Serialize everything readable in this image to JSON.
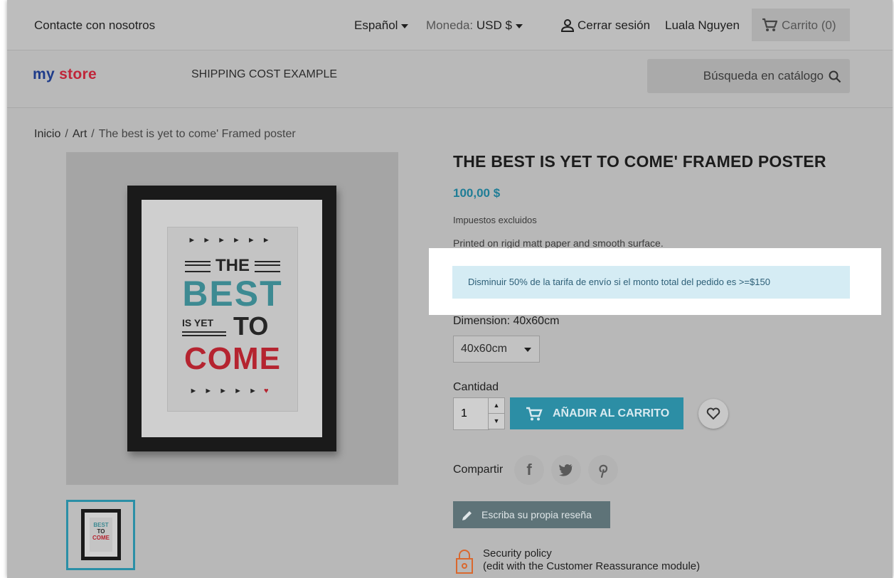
{
  "topnav": {
    "contact": "Contacte con nosotros",
    "language": "Español",
    "currency_label": "Moneda:",
    "currency_value": "USD $",
    "sign_out": "Cerrar sesión",
    "user_name": "Luala Nguyen",
    "cart": "Carrito (0)"
  },
  "header": {
    "logo_my": "my",
    "logo_store": "store",
    "menu_item": "SHIPPING COST EXAMPLE",
    "search_placeholder": "Búsqueda en catálogo"
  },
  "breadcrumb": {
    "home": "Inicio",
    "category": "Art",
    "current": "The best is yet to come' Framed poster",
    "separator": "/"
  },
  "poster": {
    "the": "THE",
    "best": "BEST",
    "is_yet": "IS YET",
    "to": "TO",
    "come": "COME",
    "arrows_top": "►►►►►►",
    "arrows_bottom": "►►►►►",
    "heart": "♥"
  },
  "thumbnail": {
    "best": "BEST",
    "to": "TO",
    "come": "COME"
  },
  "product": {
    "title": "THE BEST IS YET TO COME' FRAMED POSTER",
    "price": "100,00 $",
    "tax_note": "Impuestos excluidos",
    "description": "Printed on rigid matt paper and smooth surface.",
    "promo": "Disminuir 50% de la tarifa de envío si el monto total del pedido es >=$150",
    "dimension_label": "Dimension: 40x60cm",
    "dimension_value": "40x60cm",
    "quantity_label": "Cantidad",
    "quantity_value": "1",
    "add_to_cart": "AÑADIR AL CARRITO",
    "share_label": "Compartir",
    "social": {
      "facebook": "f",
      "twitter": "t",
      "pinterest": "p"
    },
    "write_review": "Escriba su propia reseña",
    "security_title": "Security policy",
    "security_sub": "(edit with the Customer Reassurance module)"
  },
  "colors": {
    "accent": "#2c8ea5",
    "price": "#1f7d96",
    "promo_bg": "#d5ecf4",
    "poster_teal": "#3d8a92",
    "poster_red": "#b52430",
    "security_icon": "#d9682e"
  }
}
